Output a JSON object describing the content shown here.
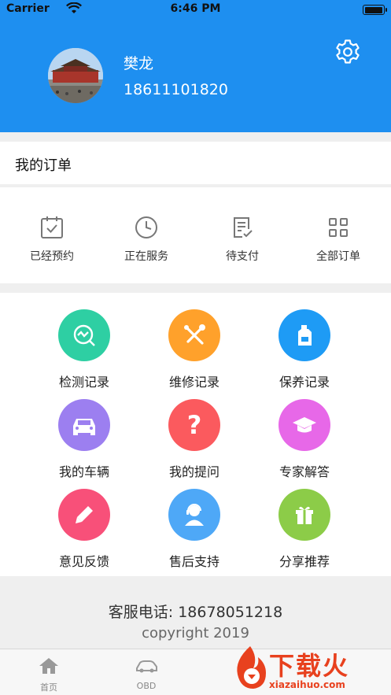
{
  "status_bar": {
    "carrier": "Carrier",
    "time": "6:46 PM"
  },
  "profile": {
    "name": "樊龙",
    "phone": "18611101820"
  },
  "orders_section": {
    "title": "我的订单",
    "items": [
      {
        "label": "已经预约",
        "icon": "calendar-check-icon"
      },
      {
        "label": "正在服务",
        "icon": "clock-icon"
      },
      {
        "label": "待支付",
        "icon": "document-check-icon"
      },
      {
        "label": "全部订单",
        "icon": "grid-icon"
      }
    ]
  },
  "services": [
    {
      "label": "检测记录",
      "icon": "diagnostic-icon",
      "color": "#2ecfa3"
    },
    {
      "label": "维修记录",
      "icon": "tools-icon",
      "color": "#ffa12b"
    },
    {
      "label": "保养记录",
      "icon": "oil-bottle-icon",
      "color": "#1e9bf5"
    },
    {
      "label": "我的车辆",
      "icon": "car-icon",
      "color": "#9c7ff0"
    },
    {
      "label": "我的提问",
      "icon": "question-icon",
      "color": "#fb5a5e"
    },
    {
      "label": "专家解答",
      "icon": "graduation-cap-icon",
      "color": "#e768e8"
    },
    {
      "label": "意见反馈",
      "icon": "pencil-icon",
      "color": "#f85079"
    },
    {
      "label": "售后支持",
      "icon": "support-agent-icon",
      "color": "#4ea8f7"
    },
    {
      "label": "分享推荐",
      "icon": "gift-icon",
      "color": "#8ccc48"
    }
  ],
  "footer": {
    "hotline": "客服电话: 18678051218",
    "copyright": "copyright 2019"
  },
  "tabbar": [
    {
      "label": "首页",
      "icon": "home-icon"
    },
    {
      "label": "OBD",
      "icon": "car-obd-icon"
    }
  ],
  "watermark": {
    "text": "下载火",
    "url": "xiazaihuo.com"
  },
  "colors": {
    "header": "#1e8ff0",
    "accent_red": "#e8411e"
  }
}
